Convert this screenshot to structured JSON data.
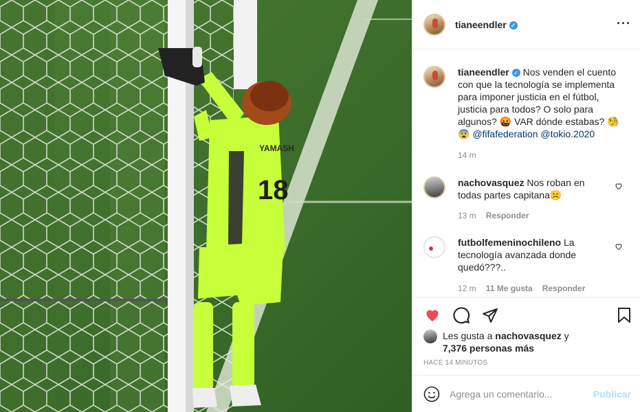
{
  "post": {
    "username": "tianeendler",
    "verified_icon": "verified-badge-icon",
    "more_icon": "more-options-icon"
  },
  "caption": {
    "username": "tianeendler",
    "text": "Nos venden el cuento con que la tecnología se implementa para imponer justicia en el fútbol, justicia para todos? O solo para algunos? 🤬 VAR dónde estabas? 🧐😨",
    "mention1": "@fifafederation",
    "mention2": "@tokio.2020",
    "time": "14 m"
  },
  "comments": [
    {
      "username": "nachovasquez",
      "text": "Nos roban en todas partes capitana☹️",
      "time": "13 m",
      "likes": "",
      "reply": "Responder"
    },
    {
      "username": "futbolfemeninochileno",
      "text": "La tecnología avanzada donde quedó???..",
      "time": "12 m",
      "likes": "11 Me gusta",
      "reply": "Responder"
    }
  ],
  "likes": {
    "prefix": "Les gusta a",
    "user": "nachovasquez",
    "joiner": "y",
    "others": "7,376 personas más"
  },
  "timestamp": "HACE 14 MINUTOS",
  "comment_box": {
    "placeholder": "Agrega un comentario...",
    "post_label": "Publicar"
  },
  "colors": {
    "like_red": "#ed4956",
    "link": "#00376b",
    "post_button_disabled": "#b2dffc",
    "verified_blue": "#3897f0"
  },
  "media": {
    "type": "photo",
    "jersey_text": "YAMASH",
    "jersey_number": "18"
  }
}
